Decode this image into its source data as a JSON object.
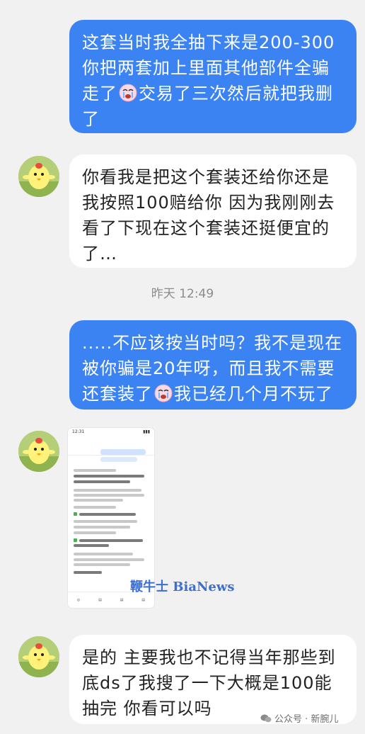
{
  "messages": [
    {
      "side": "out",
      "lines": [
        "这套当时我全抽下来是200-300",
        "你把两套加上里面其他部件全骗",
        "走了",
        "了"
      ],
      "line3_after_emoji": "交易了三次然后就把我删"
    },
    {
      "side": "in",
      "lines": [
        "你看我是把这个套装还给你还是",
        "我按照100赔给你 因为我刚刚去",
        "看了下现在这个套装还挺便宜的",
        "了…"
      ]
    },
    {
      "side": "out",
      "lines": [
        ".....不应该按当时吗？我不是现在",
        "被你骗是20年呀，而且我不需要",
        "还套装了"
      ],
      "line3_after_emoji": "我已经几个月不玩了"
    },
    {
      "side": "in",
      "lines": [
        "是的 主要我也不记得当年那些到",
        "底ds了我搜了一下大概是100能",
        "抽完 你看可以吗"
      ]
    }
  ],
  "timestamp": "昨天 12:49",
  "screenshot_message": {
    "status_time": "12:31",
    "watermark": "鞭牛士 BiaNews"
  },
  "footer": {
    "text": "公众号 · 新腕儿"
  },
  "colors": {
    "out_bubble": "#3b82f2",
    "in_bubble": "#ffffff",
    "background": "#f1f1f1",
    "timestamp": "#8c8c8c"
  },
  "icons": {
    "emoji": "crying-face-icon",
    "avatar": "chick-avatar"
  }
}
